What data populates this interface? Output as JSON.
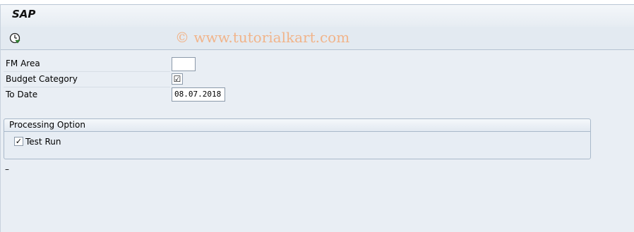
{
  "window": {
    "title": "SAP"
  },
  "toolbar": {
    "execute_icon": "execute-clock-icon",
    "watermark": "© www.tutorialkart.com"
  },
  "fields": [
    {
      "label": "FM Area",
      "value": ""
    },
    {
      "label": "Budget Category",
      "checked": true,
      "mark": "☑"
    },
    {
      "label": "To Date",
      "value": "08.07.2018"
    }
  ],
  "group": {
    "title": "Processing Option",
    "test_run": {
      "label": "Test Run",
      "checked": true,
      "mark": "✓"
    }
  },
  "status": {
    "text": "–"
  }
}
